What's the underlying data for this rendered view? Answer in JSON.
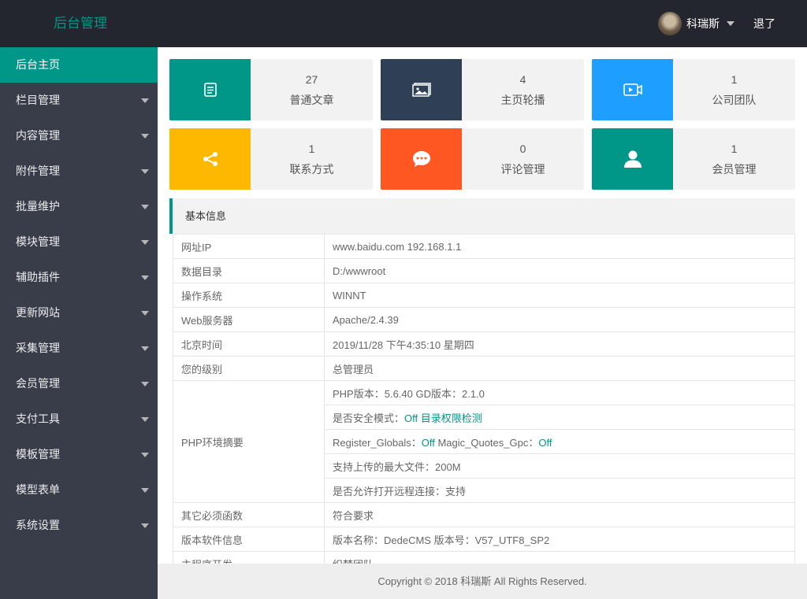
{
  "header": {
    "logo": "后台管理",
    "user_name": "科瑞斯",
    "logout": "退了"
  },
  "sidebar": {
    "items": [
      {
        "label": "后台主页",
        "active": true,
        "has_arrow": false
      },
      {
        "label": "栏目管理",
        "has_arrow": true
      },
      {
        "label": "内容管理",
        "has_arrow": true
      },
      {
        "label": "附件管理",
        "has_arrow": true
      },
      {
        "label": "批量维护",
        "has_arrow": true
      },
      {
        "label": "模块管理",
        "has_arrow": true
      },
      {
        "label": "辅助插件",
        "has_arrow": true
      },
      {
        "label": "更新网站",
        "has_arrow": true
      },
      {
        "label": "采集管理",
        "has_arrow": true
      },
      {
        "label": "会员管理",
        "has_arrow": true
      },
      {
        "label": "支付工具",
        "has_arrow": true
      },
      {
        "label": "模板管理",
        "has_arrow": true
      },
      {
        "label": "模型表单",
        "has_arrow": true
      },
      {
        "label": "系统设置",
        "has_arrow": true
      }
    ]
  },
  "cards": [
    {
      "num": "27",
      "label": "普通文章",
      "icon": "article-icon",
      "color": "#009688"
    },
    {
      "num": "4",
      "label": "主页轮播",
      "icon": "image-icon",
      "color": "#2f4056"
    },
    {
      "num": "1",
      "label": "公司团队",
      "icon": "video-icon",
      "color": "#1e9fff"
    },
    {
      "num": "1",
      "label": "联系方式",
      "icon": "share-icon",
      "color": "#ffb800"
    },
    {
      "num": "0",
      "label": "评论管理",
      "icon": "comment-icon",
      "color": "#ff5722"
    },
    {
      "num": "1",
      "label": "会员管理",
      "icon": "user-icon",
      "color": "#009688"
    }
  ],
  "info": {
    "title": "基本信息",
    "rows": {
      "url_ip": {
        "k": "网址IP",
        "v": "www.baidu.com 192.168.1.1"
      },
      "data_dir": {
        "k": "数据目录",
        "v": "D:/wwwroot"
      },
      "os": {
        "k": "操作系统",
        "v": "WINNT"
      },
      "web_server": {
        "k": "Web服务器",
        "v": "Apache/2.4.39"
      },
      "beijing_time": {
        "k": "北京时间",
        "v": "2019/11/28 下午4:35:10 星期四"
      },
      "level": {
        "k": "您的级别",
        "v": "总管理员"
      },
      "php": {
        "k": "PHP环境摘要",
        "version": "PHP版本：5.6.40 GD版本：2.1.0",
        "safe_mode_label": "是否安全模式：",
        "safe_mode_value": "Off 目录权限检测",
        "register_globals_label": "Register_Globals：",
        "register_globals_value": "Off",
        "magic_quotes_label": " Magic_Quotes_Gpc：",
        "magic_quotes_value": "Off",
        "max_upload": "支持上传的最大文件：200M",
        "remote": "是否允许打开远程连接：支持"
      },
      "functions": {
        "k": "其它必须函数",
        "v": "符合要求"
      },
      "version": {
        "k": "版本软件信息",
        "v": "版本名称：DedeCMS 版本号：V57_UTF8_SP2"
      },
      "dev": {
        "k": "主程序开发",
        "v": "织梦团队"
      }
    }
  },
  "footer": "Copyright © 2018 科瑞斯 All Rights Reserved."
}
